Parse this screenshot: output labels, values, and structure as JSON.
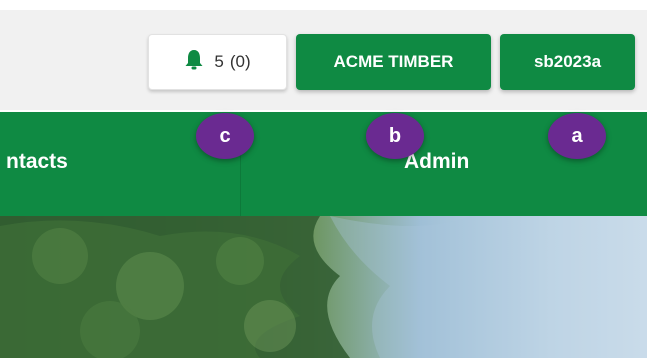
{
  "header": {
    "notifications": {
      "count": "5",
      "unread": "(0)",
      "icon": "bell-icon"
    },
    "org_label": "ACME TIMBER",
    "user_label": "sb2023a",
    "brand_color": "#0f8a43"
  },
  "nav": {
    "items": [
      {
        "label": "ntacts"
      },
      {
        "label": "Admin"
      }
    ]
  },
  "markers": [
    {
      "label": "c",
      "color": "#6a2a91"
    },
    {
      "label": "b",
      "color": "#6a2a91"
    },
    {
      "label": "a",
      "color": "#6a2a91"
    }
  ]
}
